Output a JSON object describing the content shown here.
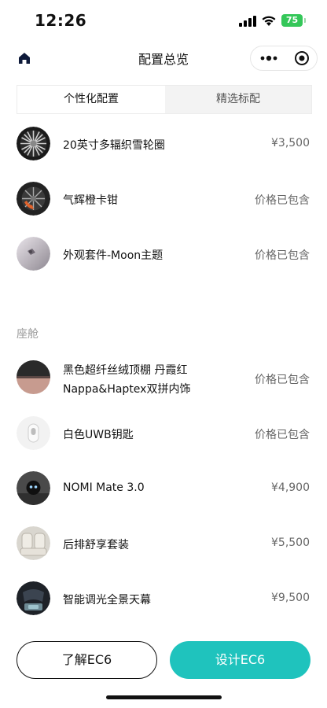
{
  "status_bar": {
    "time": "12:26",
    "battery": "75"
  },
  "nav": {
    "title": "配置总览",
    "home_icon": "home-icon",
    "more_icon": "more-dots-icon",
    "close_icon": "target-close-icon"
  },
  "tabs": [
    {
      "label": "个性化配置",
      "active": true
    },
    {
      "label": "精选标配",
      "active": false
    }
  ],
  "personalized_items": [
    {
      "name": "20英寸多辐织雪轮圈",
      "price": "¥3,500"
    },
    {
      "name": "气辉橙卡钳",
      "price": "价格已包含"
    },
    {
      "name": "外观套件-Moon主题",
      "price": "价格已包含"
    }
  ],
  "cabin": {
    "section_title": "座舱",
    "items": [
      {
        "name_line1": "黑色超纤丝绒顶棚 丹霞红",
        "name_line2": "Nappa&Haptex双拼内饰",
        "price": "价格已包含"
      },
      {
        "name": "白色UWB钥匙",
        "price": "价格已包含"
      },
      {
        "name": "NOMI Mate 3.0",
        "price": "¥4,900"
      },
      {
        "name": "后排舒享套装",
        "price": "¥5,500"
      },
      {
        "name": "智能调光全景天幕",
        "price": "¥9,500"
      }
    ]
  },
  "buttons": {
    "learn": "了解EC6",
    "design": "设计EC6"
  },
  "colors": {
    "accent": "#1fc3bd",
    "battery": "#34c759"
  }
}
